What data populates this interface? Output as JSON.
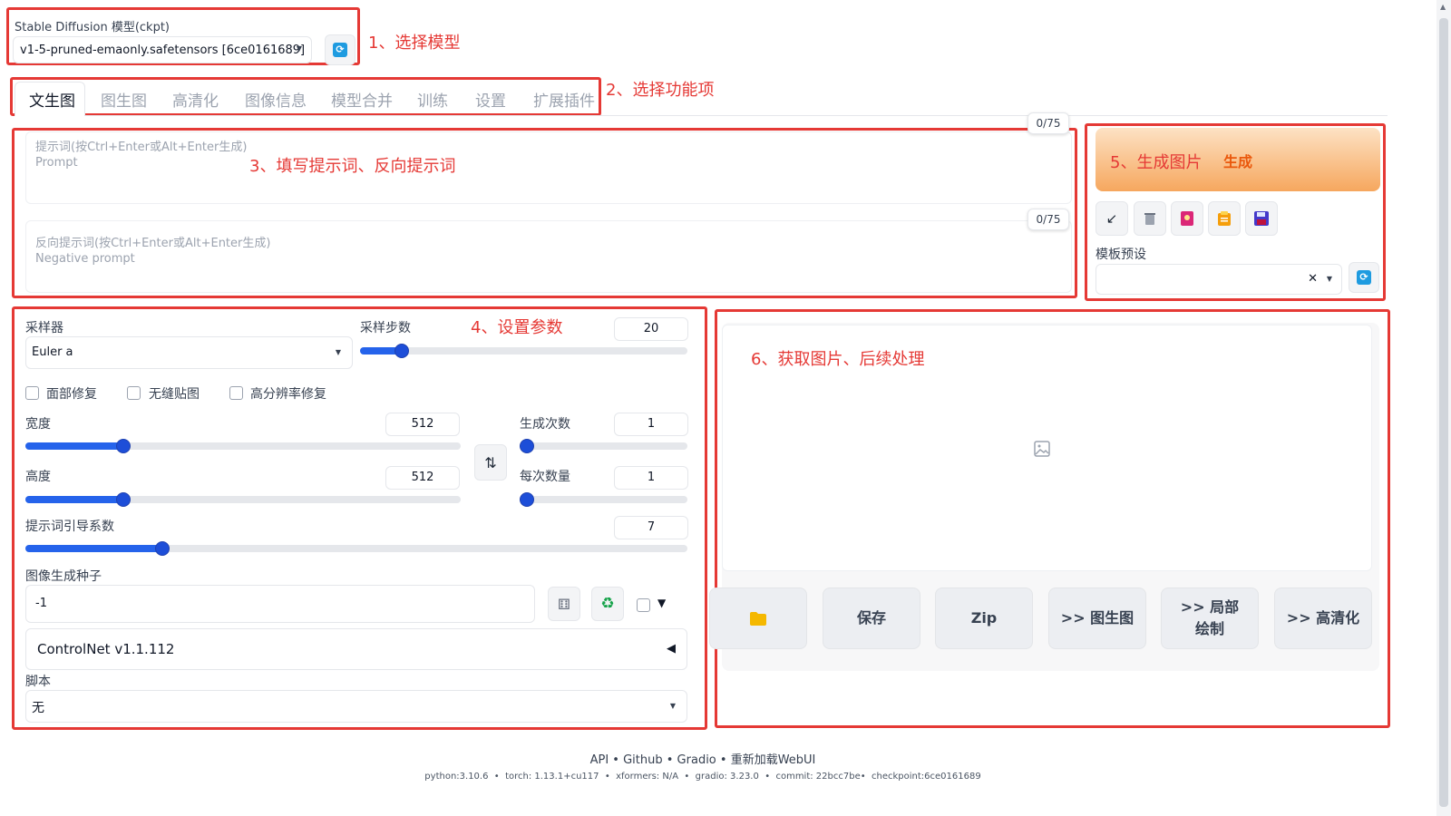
{
  "model": {
    "label": "Stable Diffusion 模型(ckpt)",
    "value": "v1-5-pruned-emaonly.safetensors [6ce0161689]"
  },
  "annotations": {
    "a1": "1、选择模型",
    "a2": "2、选择功能项",
    "a3": "3、填写提示词、反向提示词",
    "a4": "4、设置参数",
    "a5": "5、生成图片",
    "a6": "6、获取图片、后续处理"
  },
  "tabs": [
    "文生图",
    "图生图",
    "高清化",
    "图像信息",
    "模型合并",
    "训练",
    "设置",
    "扩展插件"
  ],
  "prompt": {
    "counter": "0/75",
    "placeholder_cn": "提示词(按Ctrl+Enter或Alt+Enter生成)",
    "placeholder_en": "Prompt"
  },
  "negative": {
    "counter": "0/75",
    "placeholder_cn": "反向提示词(按Ctrl+Enter或Alt+Enter生成)",
    "placeholder_en": "Negative prompt"
  },
  "generate": {
    "label": "生成",
    "preset_label": "模板预设",
    "clear_glyph": "✕",
    "accent_color": "#f6a75e"
  },
  "params": {
    "sampler_label": "采样器",
    "sampler_value": "Euler a",
    "steps_label": "采样步数",
    "steps_value": "20",
    "steps_min": 1,
    "steps_max": 150,
    "face_restore": "面部修复",
    "tiling": "无缝贴图",
    "hires_fix": "高分辨率修复",
    "width_label": "宽度",
    "width_value": "512",
    "height_label": "高度",
    "height_value": "512",
    "size_min": 64,
    "size_max": 2048,
    "batch_count_label": "生成次数",
    "batch_count_value": "1",
    "batch_size_label": "每次数量",
    "batch_size_value": "1",
    "cfg_label": "提示词引导系数",
    "cfg_value": "7",
    "cfg_min": 1,
    "cfg_max": 30,
    "seed_label": "图像生成种子",
    "seed_value": "-1",
    "extra_toggle": "▼",
    "controlnet_label": "ControlNet v1.1.112",
    "controlnet_toggle": "◀",
    "script_label": "脚本",
    "script_value": "无"
  },
  "output_buttons": {
    "save": "保存",
    "zip": "Zip",
    "to_img2img": ">> 图生图",
    "to_inpaint": ">> 局部绘制",
    "to_extras": ">> 高清化"
  },
  "footer": {
    "links": "API • Github • Gradio • 重新加载WebUI",
    "versions": "python:3.10.6  •  torch: 1.13.1+cu117  •  xformers: N/A  •  gradio: 3.23.0  •  commit: 22bcc7be•  checkpoint:6ce0161689"
  }
}
